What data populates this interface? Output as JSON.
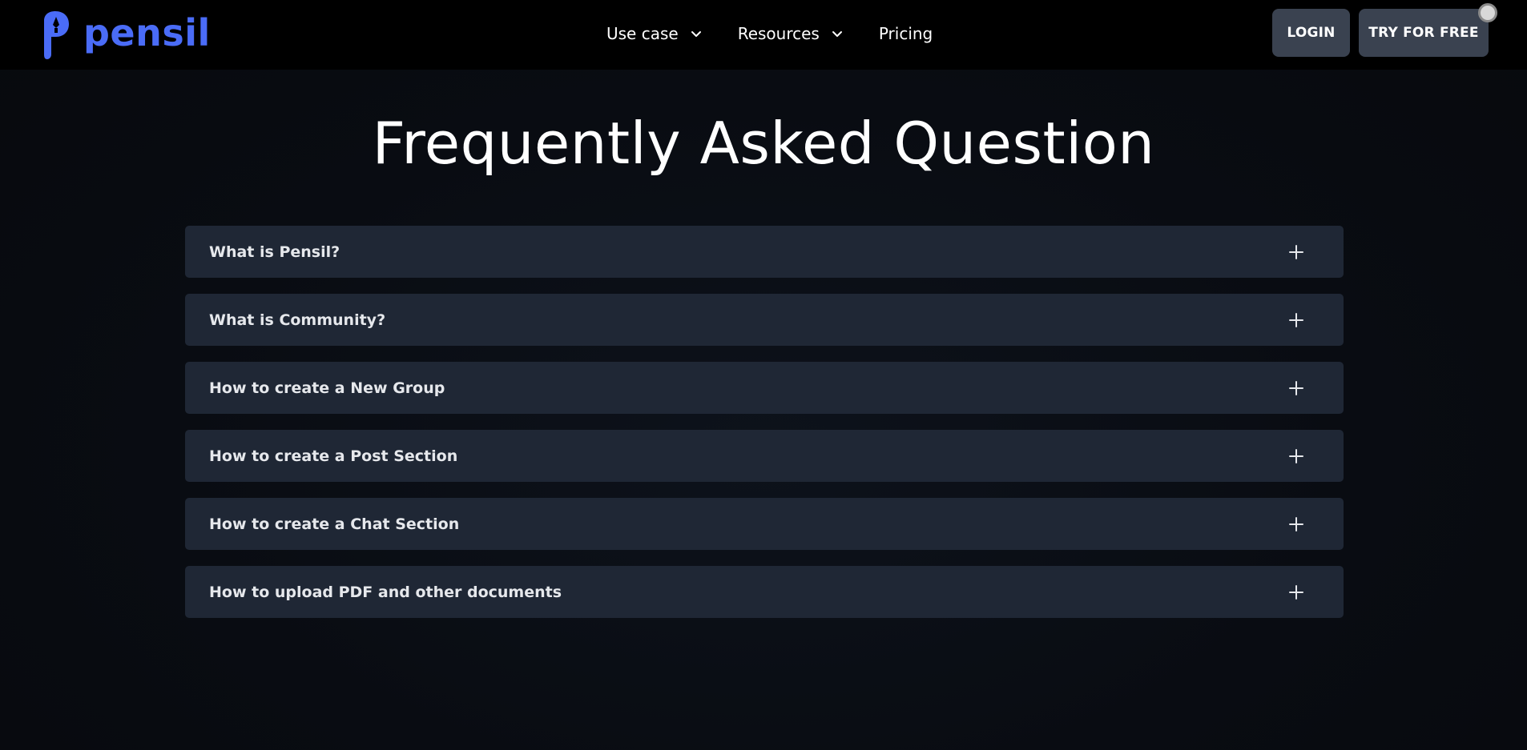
{
  "header": {
    "logo_text": "pensil",
    "nav": [
      {
        "label": "Use case",
        "has_dropdown": true
      },
      {
        "label": "Resources",
        "has_dropdown": true
      },
      {
        "label": "Pricing",
        "has_dropdown": false
      }
    ],
    "login_label": "LOGIN",
    "try_label": "TRY FOR FREE"
  },
  "faq": {
    "title": "Frequently Asked Question",
    "items": [
      {
        "question": "What is Pensil?"
      },
      {
        "question": "What is Community?"
      },
      {
        "question": "How to create a New Group"
      },
      {
        "question": "How to create a Post Section"
      },
      {
        "question": "How to create a Chat Section"
      },
      {
        "question": "How to upload PDF and other documents"
      }
    ]
  },
  "icons": {
    "logo": "pensil-logo-icon",
    "dropdown": "chevron-down-icon",
    "expand": "plus-icon"
  },
  "colors": {
    "brand": "#4a6cf7",
    "nav_bg": "#000000",
    "page_bg": "#0a0d13",
    "card_bg": "#1f2735",
    "button_bg": "#3a4250"
  }
}
